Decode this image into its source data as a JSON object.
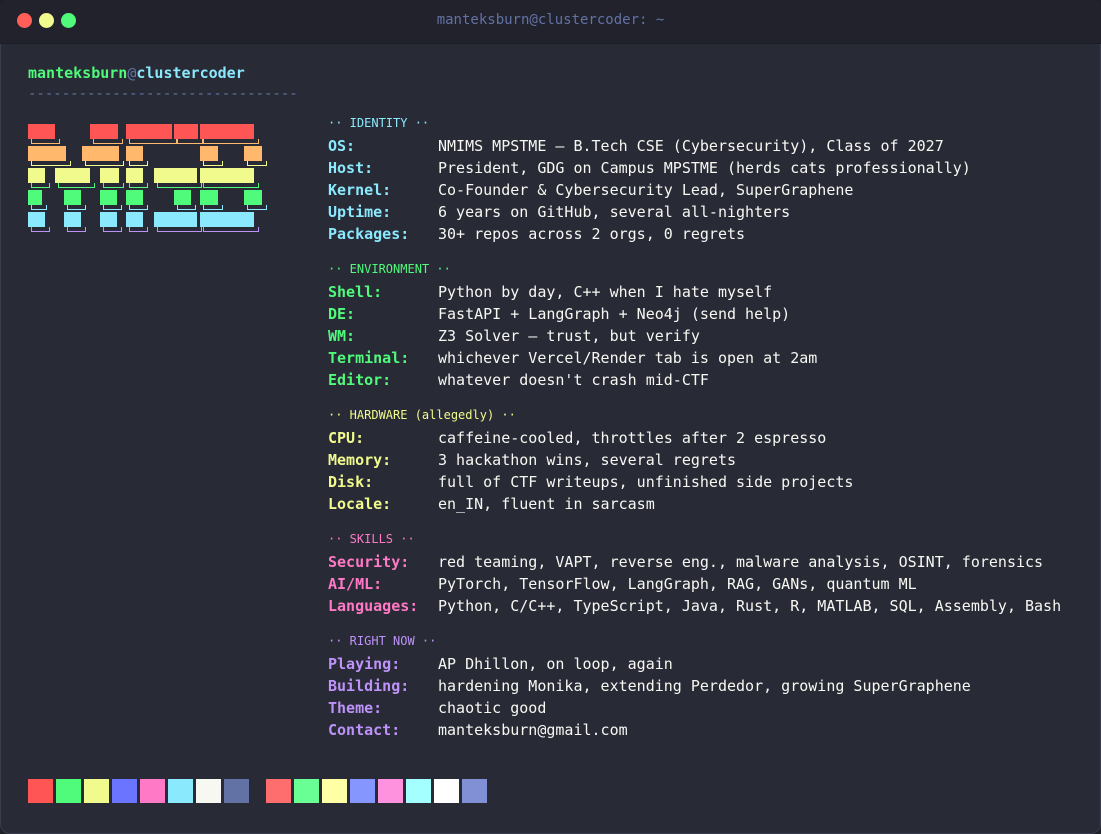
{
  "window": {
    "title": "manteksburn@clustercoder: ~"
  },
  "prompt": {
    "user": "manteksburn",
    "at": "@",
    "host": "clustercoder",
    "divider": "--------------------------------"
  },
  "sections": {
    "identity": {
      "title": "·· IDENTITY ··",
      "rows": [
        {
          "key": "OS:",
          "value": "NMIMS MPSTME — B.Tech CSE (Cybersecurity), Class of 2027"
        },
        {
          "key": "Host:",
          "value": "President, GDG on Campus MPSTME (herds cats professionally)"
        },
        {
          "key": "Kernel:",
          "value": "Co-Founder & Cybersecurity Lead, SuperGraphene"
        },
        {
          "key": "Uptime:",
          "value": "6 years on GitHub, several all-nighters"
        },
        {
          "key": "Packages:",
          "value": "30+ repos across 2 orgs, 0 regrets"
        }
      ]
    },
    "environment": {
      "title": "·· ENVIRONMENT ··",
      "rows": [
        {
          "key": "Shell:",
          "value": "Python by day, C++ when I hate myself"
        },
        {
          "key": "DE:",
          "value": "FastAPI + LangGraph + Neo4j (send help)"
        },
        {
          "key": "WM:",
          "value": "Z3 Solver — trust, but verify"
        },
        {
          "key": "Terminal:",
          "value": "whichever Vercel/Render tab is open at 2am"
        },
        {
          "key": "Editor:",
          "value": "whatever doesn't crash mid-CTF"
        }
      ]
    },
    "hardware": {
      "title": "·· HARDWARE (allegedly) ··",
      "rows": [
        {
          "key": "CPU:",
          "value": "caffeine-cooled, throttles after 2 espresso"
        },
        {
          "key": "Memory:",
          "value": "3 hackathon wins, several regrets"
        },
        {
          "key": "Disk:",
          "value": "full of CTF writeups, unfinished side projects"
        },
        {
          "key": "Locale:",
          "value": "en_IN, fluent in sarcasm"
        }
      ]
    },
    "skills": {
      "title": "·· SKILLS ··",
      "rows": [
        {
          "key": "Security:",
          "value": "red teaming, VAPT, reverse eng., malware analysis, OSINT, forensics"
        },
        {
          "key": "AI/ML:",
          "value": "PyTorch, TensorFlow, LangGraph, RAG, GANs, quantum ML"
        },
        {
          "key": "Languages:",
          "value": "Python, C/C++, TypeScript, Java, Rust, R, MATLAB, SQL, Assembly, Bash"
        }
      ]
    },
    "now": {
      "title": "·· RIGHT NOW ··",
      "rows": [
        {
          "key": "Playing:",
          "value": "AP Dhillon, on loop, again"
        },
        {
          "key": "Building:",
          "value": "hardening Monika, extending Perdedor, growing SuperGraphene"
        },
        {
          "key": "Theme:",
          "value": "chaotic good"
        },
        {
          "key": "Contact:",
          "value": "manteksburn@gmail.com"
        }
      ]
    }
  },
  "palette": {
    "normal": [
      "#ff5555",
      "#50fa7b",
      "#f1fa8c",
      "#6b74ff",
      "#ff79c6",
      "#8be9fd",
      "#f8f8f2",
      "#6272a4"
    ],
    "bright": [
      "#ff6e6e",
      "#69ff94",
      "#ffffa5",
      "#8696ff",
      "#ff92df",
      "#a4ffff",
      "#ffffff",
      "#8190d4"
    ]
  },
  "logo": {
    "colors": [
      "#ff5555",
      "#ffb86c",
      "#f1fa8c",
      "#50fa7b",
      "#8be9fd",
      "#bd93f9"
    ]
  }
}
